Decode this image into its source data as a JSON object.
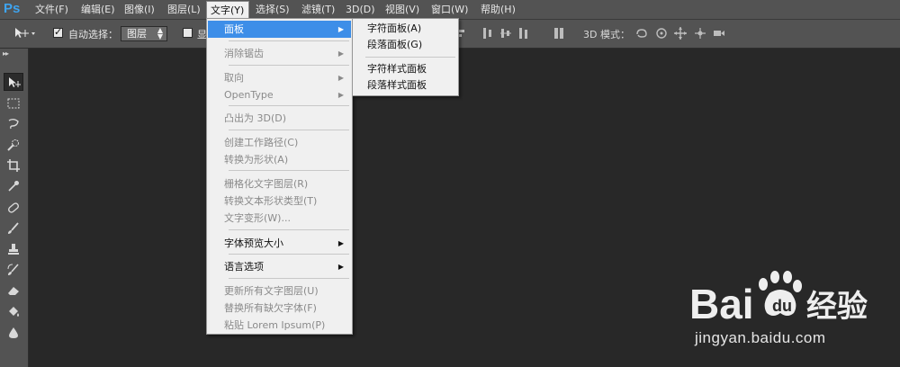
{
  "app": {
    "logo": "Ps"
  },
  "menubar": {
    "items": [
      {
        "label": "文件(F)"
      },
      {
        "label": "编辑(E)"
      },
      {
        "label": "图像(I)"
      },
      {
        "label": "图层(L)"
      },
      {
        "label": "文字(Y)"
      },
      {
        "label": "选择(S)"
      },
      {
        "label": "滤镜(T)"
      },
      {
        "label": "3D(D)"
      },
      {
        "label": "视图(V)"
      },
      {
        "label": "窗口(W)"
      },
      {
        "label": "帮助(H)"
      }
    ],
    "active": "文字(Y)"
  },
  "options": {
    "tool_icon": "move-tool-icon",
    "auto_select_label": "自动选择：",
    "auto_select_checked": true,
    "auto_select_value": "图层",
    "show_label": "显",
    "mode_label": "3D 模式："
  },
  "tools": [
    "move-tool-icon",
    "marquee-tool-icon",
    "lasso-tool-icon",
    "quick-selection-icon",
    "crop-tool-icon",
    "eyedropper-icon",
    "healing-brush-icon",
    "brush-tool-icon",
    "clone-stamp-icon",
    "history-brush-icon",
    "eraser-icon",
    "paint-bucket-icon",
    "blur-tool-icon"
  ],
  "dropdown": {
    "items": [
      {
        "label": "面板",
        "enabled": true,
        "highlight": true,
        "submenu": true
      },
      {
        "label": "消除锯齿",
        "enabled": false,
        "submenu": true
      },
      {
        "label": "取向",
        "enabled": false,
        "submenu": true
      },
      {
        "label": "OpenType",
        "enabled": false,
        "submenu": true
      },
      {
        "label": "凸出为 3D(D)",
        "enabled": false
      },
      {
        "label": "创建工作路径(C)",
        "enabled": false
      },
      {
        "label": "转换为形状(A)",
        "enabled": false
      },
      {
        "label": "栅格化文字图层(R)",
        "enabled": false
      },
      {
        "label": "转换文本形状类型(T)",
        "enabled": false
      },
      {
        "label": "文字变形(W)...",
        "enabled": false
      },
      {
        "label": "字体预览大小",
        "enabled": true,
        "submenu": true
      },
      {
        "label": "语言选项",
        "enabled": true,
        "submenu": true
      },
      {
        "label": "更新所有文字图层(U)",
        "enabled": false
      },
      {
        "label": "替换所有缺欠字体(F)",
        "enabled": false
      },
      {
        "label": "粘贴 Lorem Ipsum(P)",
        "enabled": false
      }
    ]
  },
  "submenu": {
    "items": [
      {
        "label": "字符面板(A)"
      },
      {
        "label": "段落面板(G)"
      },
      {
        "label": "字符样式面板"
      },
      {
        "label": "段落样式面板"
      }
    ]
  },
  "watermark": {
    "url": "jingyan.baidu.com"
  },
  "colors": {
    "highlight": "#3d8ee8",
    "canvas": "#282828",
    "panel": "#535353"
  }
}
